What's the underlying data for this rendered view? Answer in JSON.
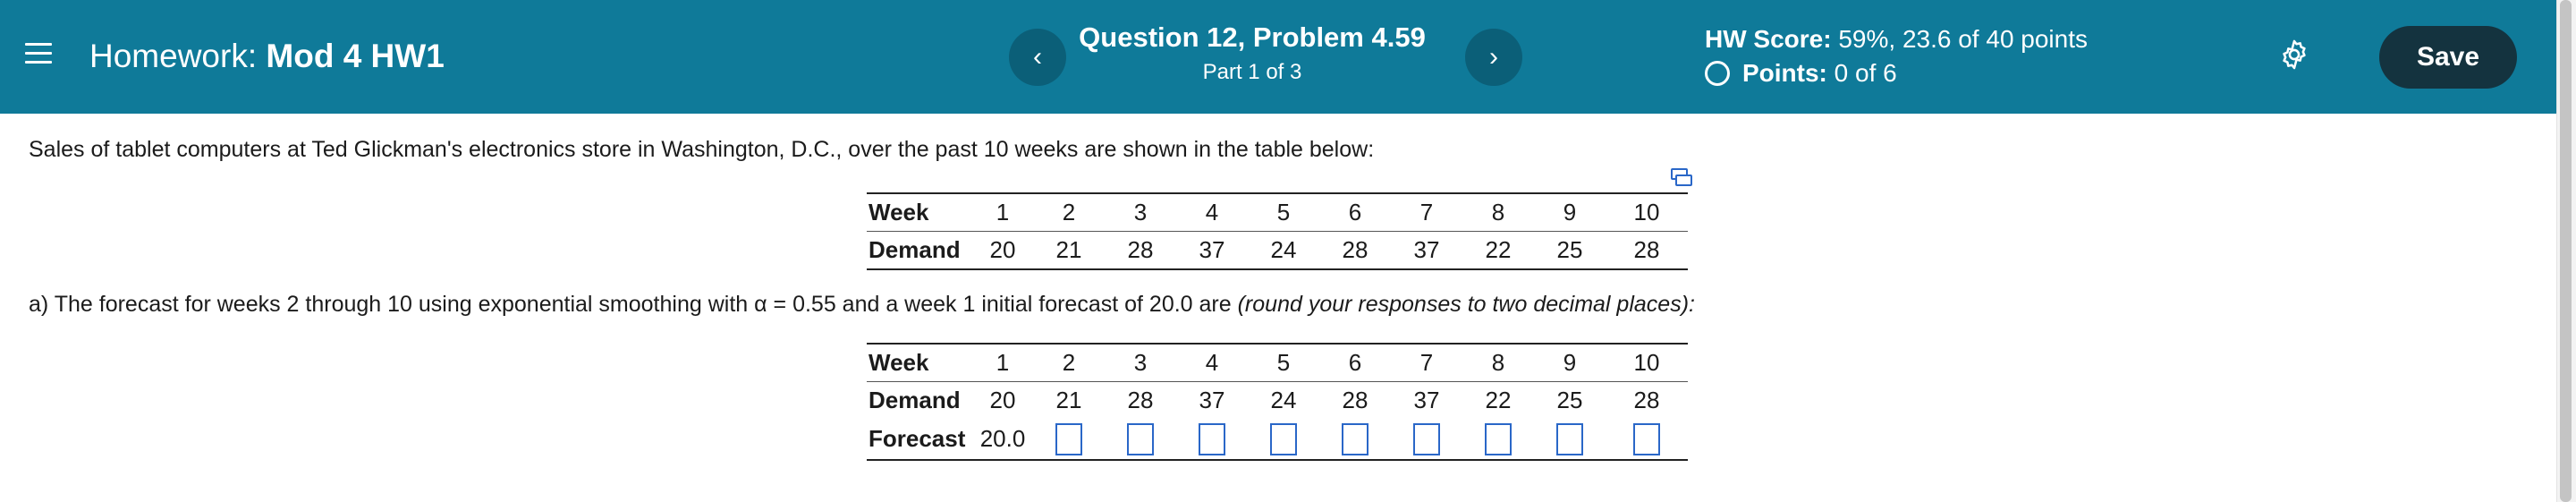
{
  "header": {
    "hw_label": "Homework:",
    "hw_name": "Mod 4 HW1",
    "question_title": "Question 12, Problem 4.59",
    "question_part": "Part 1 of 3",
    "prev_symbol": "‹",
    "next_symbol": "›",
    "score_label": "HW Score:",
    "score_value": "59%, 23.6 of 40 points",
    "points_label": "Points:",
    "points_value": "0 of 6",
    "save_label": "Save",
    "colors": {
      "bar": "#0f7a99",
      "nav_button": "#0b5f78",
      "save_button": "#14333f"
    },
    "icons": [
      "menu-icon",
      "chevron-left-icon",
      "chevron-right-icon",
      "circle-icon",
      "gear-icon"
    ]
  },
  "problem": {
    "statement": "Sales of tablet computers at Ted Glickman's electronics store in Washington, D.C., over the past 10 weeks are shown in the table below:",
    "table1": {
      "week_label": "Week",
      "demand_label": "Demand",
      "weeks": [
        "1",
        "2",
        "3",
        "4",
        "5",
        "6",
        "7",
        "8",
        "9",
        "10"
      ],
      "demand": [
        "20",
        "21",
        "28",
        "37",
        "24",
        "28",
        "37",
        "22",
        "25",
        "28"
      ]
    },
    "part_a_text": "a) The forecast for weeks 2 through 10 using exponential smoothing with α = 0.55 and a week 1 initial forecast of 20.0 are ",
    "part_a_note": "(round your responses to two decimal places):",
    "table2": {
      "week_label": "Week",
      "demand_label": "Demand",
      "forecast_label": "Forecast",
      "weeks": [
        "1",
        "2",
        "3",
        "4",
        "5",
        "6",
        "7",
        "8",
        "9",
        "10"
      ],
      "demand": [
        "20",
        "21",
        "28",
        "37",
        "24",
        "28",
        "37",
        "22",
        "25",
        "28"
      ],
      "forecast_week1": "20.0",
      "forecast_inputs": [
        "",
        "",
        "",
        "",
        "",
        "",
        "",
        "",
        ""
      ]
    }
  }
}
